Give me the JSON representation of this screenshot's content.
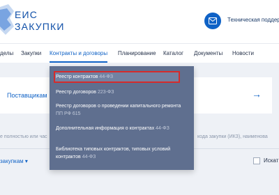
{
  "header": {
    "logo_line1": "ЕИС",
    "logo_line2": "ЗАКУПКИ",
    "support_label": "Техническая поддер",
    "support_icon": "mail-icon"
  },
  "nav": {
    "items": [
      "делы",
      "Закупки",
      "Контракты и договоры",
      "Планирование",
      "Каталог",
      "Документы",
      "Новости"
    ],
    "active_index": 2
  },
  "dropdown": {
    "items": [
      {
        "label": "Реестр контрактов",
        "law": "44-ФЗ",
        "highlighted": true
      },
      {
        "label": "Реестр договоров",
        "law": "223-ФЗ"
      },
      {
        "label": "Реестр договоров о проведении капитального ремонта",
        "law": "ПП РФ 615"
      },
      {
        "label": "Дополнительная информация о контрактах",
        "law": "44-ФЗ"
      },
      {
        "label": "Библиотека типовых контрактов, типовых условий контрактов",
        "law": "44-ФЗ"
      }
    ]
  },
  "card": {
    "label": "Поставщикам",
    "arrow": "→"
  },
  "search": {
    "hint_left": "е полностью или час",
    "hint_right": "кода закупки (ИКЗ), наименова"
  },
  "sort": {
    "label": "закупкам ▾"
  },
  "checkbox": {
    "label": "Искат"
  },
  "colors": {
    "brand": "#0f62c6",
    "dropdown_bg": "#5f6f8f",
    "highlight_border": "#d62b2b"
  }
}
